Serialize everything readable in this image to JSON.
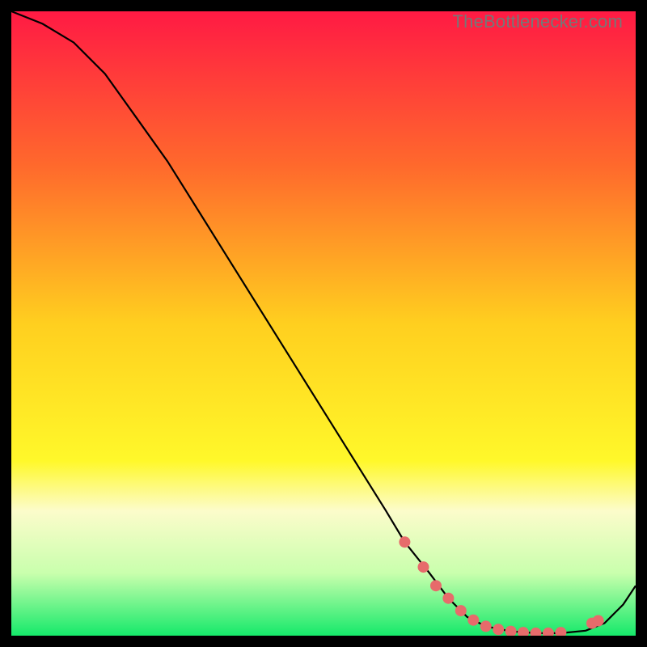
{
  "watermark": "TheBottlenecker.com",
  "chart_data": {
    "type": "line",
    "title": "",
    "xlabel": "",
    "ylabel": "",
    "xlim": [
      0,
      100
    ],
    "ylim": [
      0,
      100
    ],
    "grid": false,
    "legend": false,
    "gradient_stops": [
      {
        "t": 0.0,
        "color": "#ff1a44"
      },
      {
        "t": 0.25,
        "color": "#ff6a2c"
      },
      {
        "t": 0.5,
        "color": "#ffcf1f"
      },
      {
        "t": 0.72,
        "color": "#fff82a"
      },
      {
        "t": 0.8,
        "color": "#fcfccb"
      },
      {
        "t": 0.9,
        "color": "#c9ffad"
      },
      {
        "t": 1.0,
        "color": "#15e96a"
      }
    ],
    "series": [
      {
        "name": "curve",
        "color": "#000000",
        "x": [
          0,
          5,
          10,
          15,
          20,
          25,
          30,
          35,
          40,
          45,
          50,
          55,
          60,
          63,
          67,
          70,
          73,
          76,
          80,
          84,
          88,
          92,
          95,
          98,
          100
        ],
        "y": [
          100,
          98,
          95,
          90,
          83,
          76,
          68,
          60,
          52,
          44,
          36,
          28,
          20,
          15,
          10,
          6,
          3,
          1.5,
          0.7,
          0.4,
          0.4,
          0.8,
          2,
          5,
          8
        ]
      }
    ],
    "markers": {
      "name": "dots",
      "color": "#e76b6b",
      "radius_px": 7,
      "x": [
        63,
        66,
        68,
        70,
        72,
        74,
        76,
        78,
        80,
        82,
        84,
        86,
        88,
        93,
        94
      ],
      "y": [
        15,
        11,
        8,
        6,
        4,
        2.5,
        1.5,
        1,
        0.7,
        0.5,
        0.4,
        0.4,
        0.5,
        2,
        2.4
      ]
    }
  }
}
